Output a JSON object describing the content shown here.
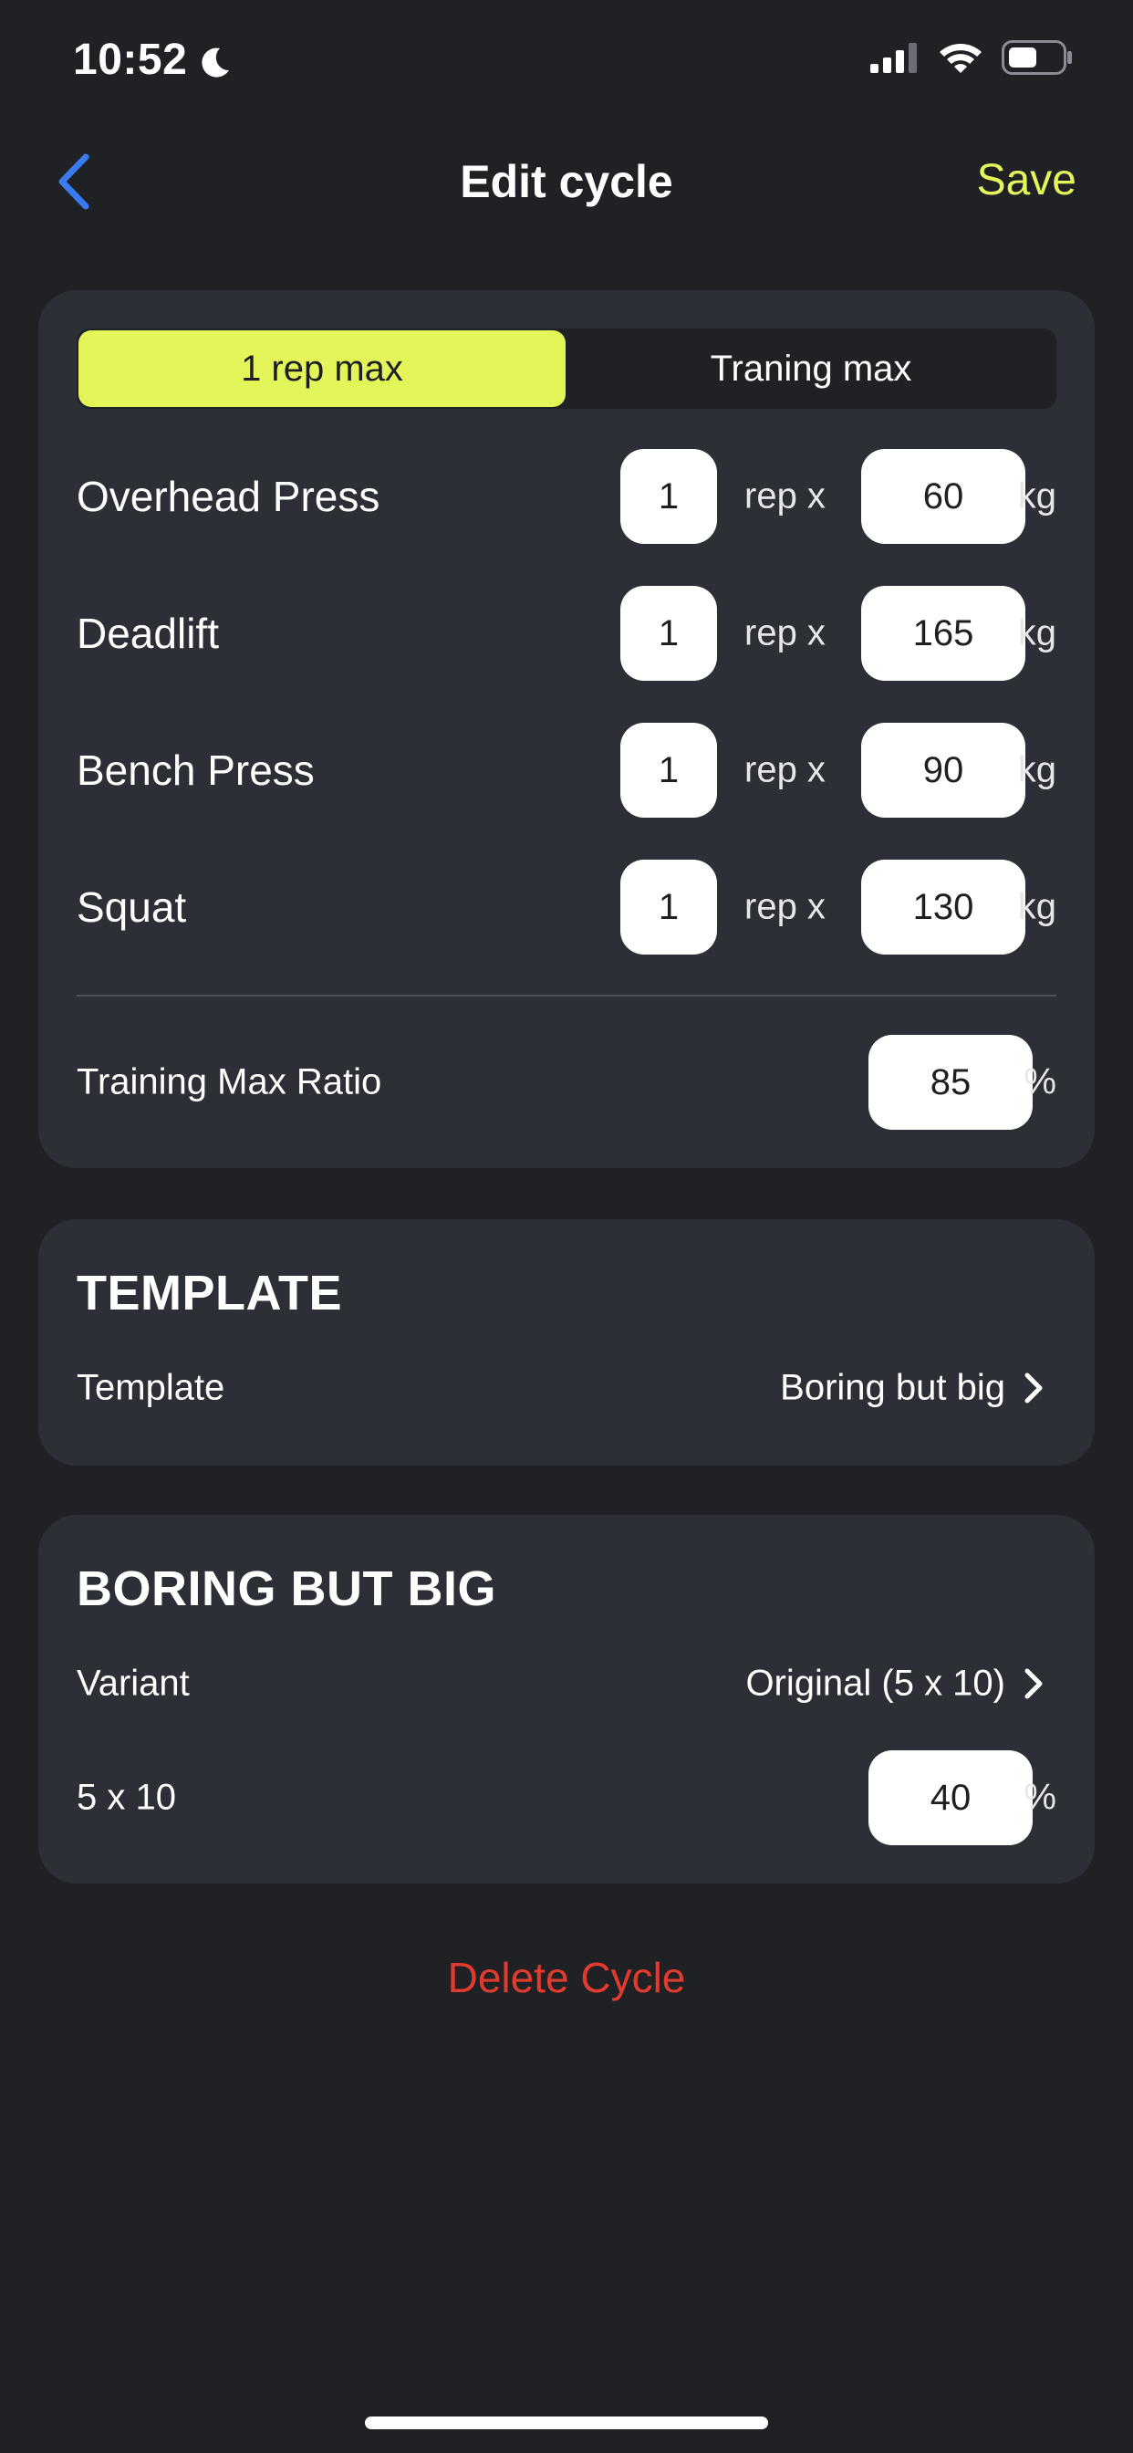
{
  "status_bar": {
    "time": "10:52",
    "icons": [
      "moon-icon",
      "signal-icon",
      "wifi-icon",
      "battery-icon"
    ]
  },
  "nav": {
    "back_icon": "chevron-left-icon",
    "title": "Edit cycle",
    "save_label": "Save"
  },
  "colors": {
    "accent": "#e4f55a",
    "back": "#3a7bf2",
    "danger": "#e23b2e",
    "background": "#1f2125",
    "card": "#2c2f36"
  },
  "max_mode": {
    "options": [
      "1 rep max",
      "Traning max"
    ],
    "selected": "1 rep max"
  },
  "lifts": [
    {
      "name": "Overhead Press",
      "reps": "1",
      "rep_label": "rep x",
      "weight": "60",
      "unit": "kg"
    },
    {
      "name": "Deadlift",
      "reps": "1",
      "rep_label": "rep x",
      "weight": "165",
      "unit": "kg"
    },
    {
      "name": "Bench Press",
      "reps": "1",
      "rep_label": "rep x",
      "weight": "90",
      "unit": "kg"
    },
    {
      "name": "Squat",
      "reps": "1",
      "rep_label": "rep x",
      "weight": "130",
      "unit": "kg"
    }
  ],
  "training_max_ratio": {
    "label": "Training Max Ratio",
    "value": "85",
    "unit": "%"
  },
  "template_section": {
    "title": "TEMPLATE",
    "label": "Template",
    "value": "Boring but big"
  },
  "bbb_section": {
    "title": "BORING BUT BIG",
    "variant_label": "Variant",
    "variant_value": "Original (5 x 10)",
    "scheme_label": "5 x 10",
    "scheme_value": "40",
    "scheme_unit": "%"
  },
  "delete_label": "Delete Cycle"
}
